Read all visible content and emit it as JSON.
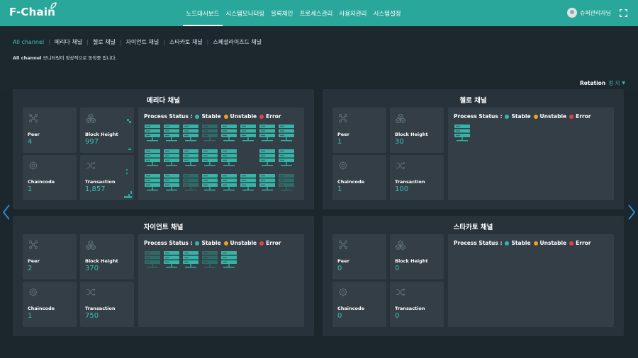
{
  "app": {
    "logo": "F-Chain",
    "nav": [
      "노드대시보드",
      "시스템모니터링",
      "블록체인",
      "프로세스관리",
      "사용자관리",
      "시스템설정"
    ],
    "active_nav": 0,
    "user_name": "슈퍼관리자님"
  },
  "channel_tabs": [
    "All channel",
    "메리다 채널",
    "첼로 채널",
    "자이언트 채널",
    "스타카토 채널",
    "스페셜라이즈드 채널"
  ],
  "active_channel_tab": 0,
  "status_message": {
    "channel": "All channel",
    "text": "모니터링이 정상적으로 동작중 입니다."
  },
  "rotation": {
    "label": "Rotation",
    "value": "정 지"
  },
  "legend": {
    "prefix": "Process Status :",
    "stable": "Stable",
    "unstable": "Unstable",
    "error": "Error"
  },
  "colors": {
    "accent": "#2aa79b",
    "stable": "#2bb9ab",
    "unstable": "#f0a11b",
    "error": "#e8424a",
    "server_on": "#36b4a6",
    "server_off": "#2f6b67"
  },
  "panels": [
    {
      "title": "메리다 채널",
      "peer_label": "Peer",
      "peer": "4",
      "block_label": "Block Height",
      "block": "997",
      "chaincode_label": "Chaincode",
      "chaincode": "1",
      "tx_label": "Transaction",
      "tx": "1,857",
      "servers": [
        [
          1,
          1,
          1,
          0,
          1,
          1,
          1,
          1
        ],
        [
          1,
          1,
          1,
          1,
          1,
          -1,
          1,
          1
        ],
        [
          1,
          1,
          0,
          1,
          1,
          1,
          1,
          0
        ]
      ]
    },
    {
      "title": "첼로 채널",
      "peer_label": "Peer",
      "peer": "1",
      "block_label": "Block Height",
      "block": "30",
      "chaincode_label": "Chaincode",
      "chaincode": "1",
      "tx_label": "Transaction",
      "tx": "100",
      "servers": [
        [
          1
        ]
      ]
    },
    {
      "title": "자이언트 채널",
      "peer_label": "Peer",
      "peer": "2",
      "block_label": "Block Height",
      "block": "370",
      "chaincode_label": "Chaincode",
      "chaincode": "1",
      "tx_label": "Transaction",
      "tx": "750",
      "servers": [
        [
          0,
          1,
          1,
          0,
          1
        ]
      ]
    },
    {
      "title": "스타카토 채널",
      "peer_label": "Peer",
      "peer": "0",
      "block_label": "Block Height",
      "block": "0",
      "chaincode_label": "Chaincode",
      "chaincode": "0",
      "tx_label": "Transaction",
      "tx": "0",
      "servers": []
    }
  ]
}
